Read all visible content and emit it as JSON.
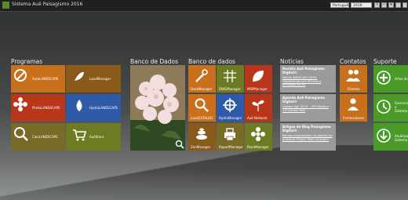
{
  "app": {
    "title": "Sistema Auê Paisagismo 2016"
  },
  "topbar": {
    "language": "Português (I",
    "theme": "2016 (monte)",
    "btn_i": "I",
    "btn_minus": "−",
    "btn_plus": "+"
  },
  "groups": {
    "programas": "Programas",
    "banco_dados_1": "Banco de Dados",
    "banco_dados_2": "Banco de dados",
    "noticias": "Notícias",
    "contatos": "Contatos",
    "suporte": "Suporte"
  },
  "programas": [
    {
      "label": "AutoLANDSCAPE"
    },
    {
      "label": "LandManager"
    },
    {
      "label": "PhotoLANDSCAPE"
    },
    {
      "label": "HydroLANDSCAPE"
    },
    {
      "label": "CalcLANDSCAPE"
    },
    {
      "label": "AuêStore"
    }
  ],
  "banco": [
    {
      "label": "DeskManager"
    },
    {
      "label": "DWGManager"
    },
    {
      "label": "MSPManager"
    },
    {
      "label": "LandCATALOG"
    },
    {
      "label": "HydroManager"
    },
    {
      "label": "Auê Network"
    },
    {
      "label": "ZenManager"
    },
    {
      "label": "ReportManager"
    },
    {
      "label": "PlantManager"
    }
  ],
  "noticias": [
    {
      "title": "Revista Auê Paisagismo Digital®",
      "body": "Mobile ANDSCAPE 2016: Trabalhando com 3D com a facilidade do 2D"
    },
    {
      "title": "Agenda Auê Paisagismo Digital®",
      "body": "Garden Hair 2013 – 14ª Edição a 11ª Garden Hair"
    },
    {
      "title": "Artigos de Blog Paisagismo Digital®",
      "body": "Plantas ornamentais: As plantas do Antiáqua (Flower Pots) na Jardim"
    }
  ],
  "contatos": [
    {
      "label": "Clientes"
    },
    {
      "label": "Fornecedores"
    }
  ],
  "suporte": [
    {
      "label": "Artes de"
    },
    {
      "label": "Gerenciar a Sistema"
    },
    {
      "label": "Atualizar Sistema"
    }
  ]
}
